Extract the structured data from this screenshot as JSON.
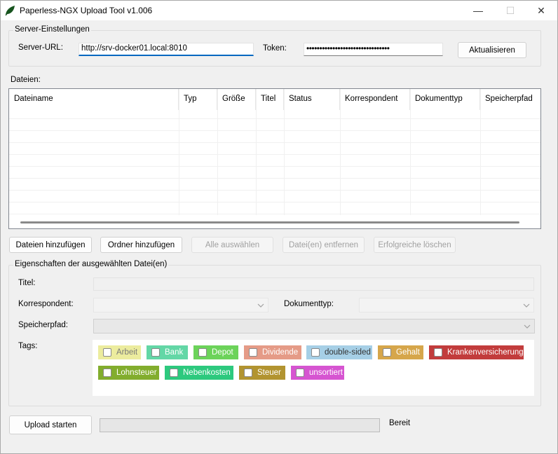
{
  "window": {
    "title": "Paperless-NGX Upload Tool v1.006",
    "minimize_glyph": "—",
    "maximize_glyph": "☐",
    "close_glyph": "✕"
  },
  "server": {
    "group_title": "Server-Einstellungen",
    "url_label": "Server-URL:",
    "url_value": "http://srv-docker01.local:8010",
    "token_label": "Token:",
    "token_value": "••••••••••••••••••••••••••••••••",
    "refresh_button": "Aktualisieren"
  },
  "files": {
    "label": "Dateien:",
    "columns": [
      "Dateiname",
      "Typ",
      "Größe",
      "Titel",
      "Status",
      "Korrespondent",
      "Dokumenttyp",
      "Speicherpfad"
    ],
    "rows": []
  },
  "file_buttons": {
    "add_files": "Dateien hinzufügen",
    "add_folder": "Ordner hinzufügen",
    "select_all": "Alle auswählen",
    "remove_files": "Datei(en) entfernen",
    "clear_success": "Erfolgreiche löschen"
  },
  "properties": {
    "group_title": "Eigenschaften der ausgewählten Datei(en)",
    "title_label": "Titel:",
    "correspondent_label": "Korrespondent:",
    "doctype_label": "Dokumenttyp:",
    "storage_label": "Speicherpfad:",
    "tags_label": "Tags:",
    "tags": [
      {
        "label": "Arbeit",
        "color": "#ecec9e",
        "text_color": "#7a7a7a"
      },
      {
        "label": "Bank",
        "color": "#63d7a6",
        "text_color": "#ffffff"
      },
      {
        "label": "Depot",
        "color": "#6cd35a",
        "text_color": "#ffffff"
      },
      {
        "label": "Dividende",
        "color": "#e59b87",
        "text_color": "#ffffff"
      },
      {
        "label": "double-sided",
        "color": "#a6cfe6",
        "text_color": "#333333"
      },
      {
        "label": "Gehalt",
        "color": "#d6a64b",
        "text_color": "#ffffff"
      },
      {
        "label": "Krankenversicherung",
        "color": "#c23c3c",
        "text_color": "#ffffff"
      },
      {
        "label": "Lohnsteuer",
        "color": "#82ad2d",
        "text_color": "#ffffff"
      },
      {
        "label": "Nebenkosten",
        "color": "#2dc97e",
        "text_color": "#ffffff"
      },
      {
        "label": "Steuer",
        "color": "#b29430",
        "text_color": "#ffffff"
      },
      {
        "label": "unsortiert",
        "color": "#d655d1",
        "text_color": "#ffffff"
      }
    ]
  },
  "footer": {
    "upload_button": "Upload starten",
    "progress": 0,
    "status": "Bereit"
  }
}
